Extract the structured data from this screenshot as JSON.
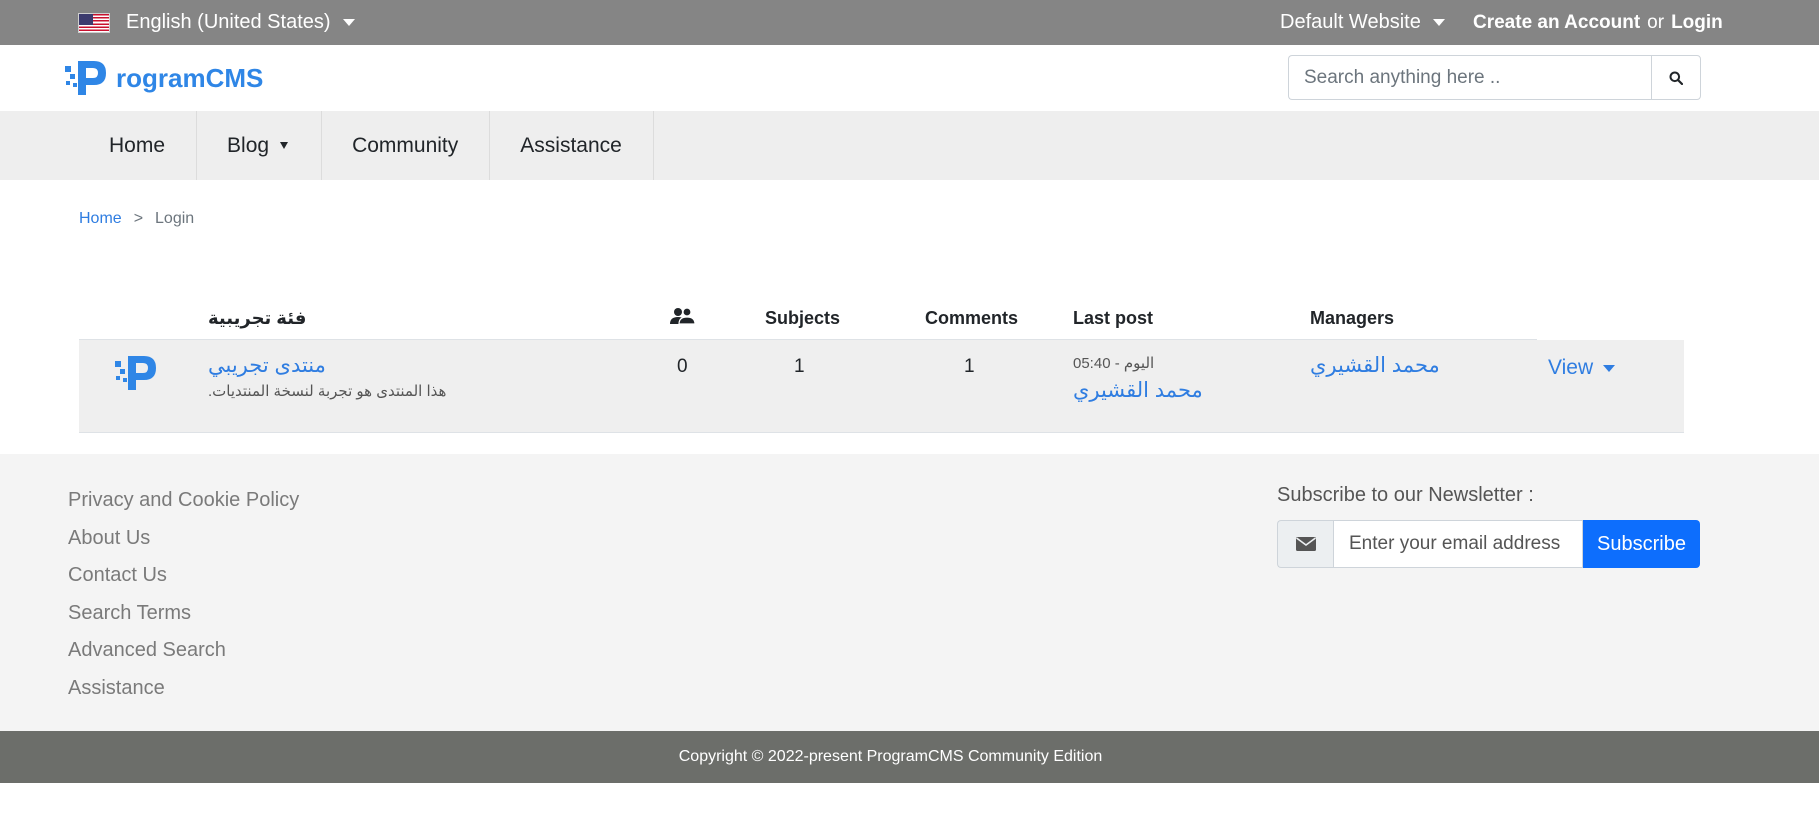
{
  "topbar": {
    "language": "English (United States)",
    "website": "Default Website",
    "create_account": "Create an Account",
    "or": "or",
    "login": "Login"
  },
  "header": {
    "logo_text": "rogramCMS",
    "search_placeholder": "Search anything here .."
  },
  "nav": {
    "items": [
      {
        "label": "Home"
      },
      {
        "label": "Blog"
      },
      {
        "label": "Community"
      },
      {
        "label": "Assistance"
      }
    ]
  },
  "breadcrumb": {
    "home": "Home",
    "separator": ">",
    "current": "Login"
  },
  "forum": {
    "category": "فئة تجريبية",
    "columns": {
      "subjects": "Subjects",
      "comments": "Comments",
      "last_post": "Last post",
      "managers": "Managers"
    },
    "rows": [
      {
        "title": "منتدى تجريبي",
        "description": "هذا المنتدى هو تجربة لنسخة المنتديات.",
        "members": "0",
        "subjects": "1",
        "comments": "1",
        "last_post_time": "اليوم - 05:40",
        "last_post_user": "محمد القشيري",
        "manager": "محمد القشيري",
        "view_label": "View"
      }
    ]
  },
  "footer": {
    "links": [
      {
        "label": "Privacy and Cookie Policy"
      },
      {
        "label": "About Us"
      },
      {
        "label": "Contact Us"
      },
      {
        "label": "Search Terms"
      },
      {
        "label": "Advanced Search"
      },
      {
        "label": "Assistance"
      }
    ],
    "newsletter_title": "Subscribe to our Newsletter :",
    "email_placeholder": "Enter your email address",
    "subscribe_label": "Subscribe",
    "copyright": "Copyright © 2022-present ProgramCMS Community Edition"
  },
  "colors": {
    "accent": "#2f7de1",
    "topbar": "#858585",
    "subscribe": "#0d6efd",
    "copyright_bar": "#6c6e6a"
  },
  "icons": {
    "flag": "us-flag-icon",
    "search": "search-icon",
    "members": "users-icon",
    "envelope": "envelope-icon",
    "logo": "programcms-logo-icon"
  }
}
